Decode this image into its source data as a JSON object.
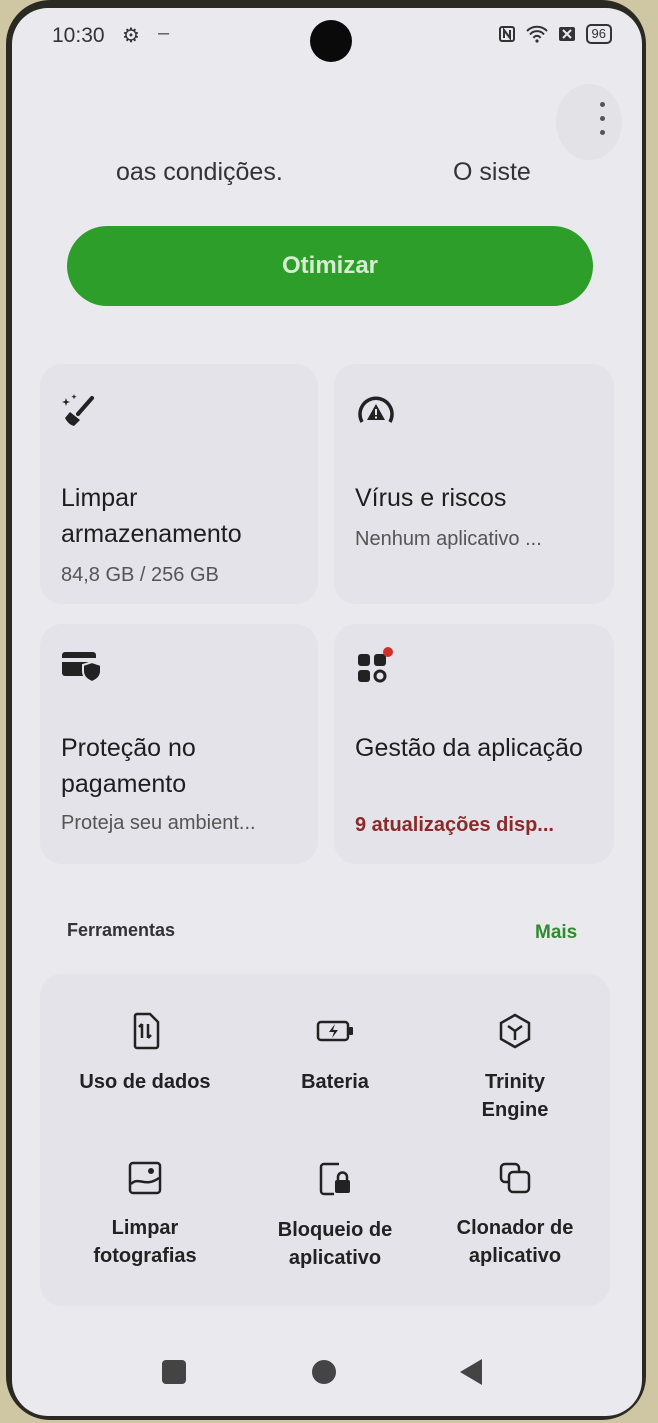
{
  "status_bar": {
    "time": "10:30",
    "right_icons": [
      "nfc-icon",
      "wifi-icon",
      "sim-icon"
    ],
    "battery": "96"
  },
  "marquee": {
    "text_1": "oas condições.",
    "text_2": "O siste"
  },
  "optimize_button": "Otimizar",
  "cards": {
    "storage": {
      "title": "Limpar armazenamento",
      "subtitle": "84,8 GB / 256 GB"
    },
    "virus": {
      "title": "Vírus e riscos",
      "subtitle": "Nenhum aplicativo ..."
    },
    "payment": {
      "title": "Proteção no pagamento",
      "subtitle": "Proteja seu ambient..."
    },
    "apps": {
      "title": "Gestão da aplicação",
      "subtitle": "9 atualizações disp..."
    }
  },
  "tools_section": {
    "label": "Ferramentas",
    "more": "Mais",
    "items": [
      {
        "label": "Uso de dados",
        "icon": "data-usage-icon"
      },
      {
        "label": "Bateria",
        "icon": "battery-icon"
      },
      {
        "label": "Trinity Engine",
        "icon": "trinity-engine-icon"
      },
      {
        "label": "Limpar fotografias",
        "icon": "photo-clean-icon"
      },
      {
        "label": "Bloqueio de aplicativo",
        "icon": "app-lock-icon"
      },
      {
        "label": "Clonador de aplicativo",
        "icon": "app-clone-icon"
      }
    ]
  },
  "colors": {
    "accent_green": "#2e9e2a",
    "alert_red": "#8b2a2a",
    "badge_red": "#d0302a"
  }
}
